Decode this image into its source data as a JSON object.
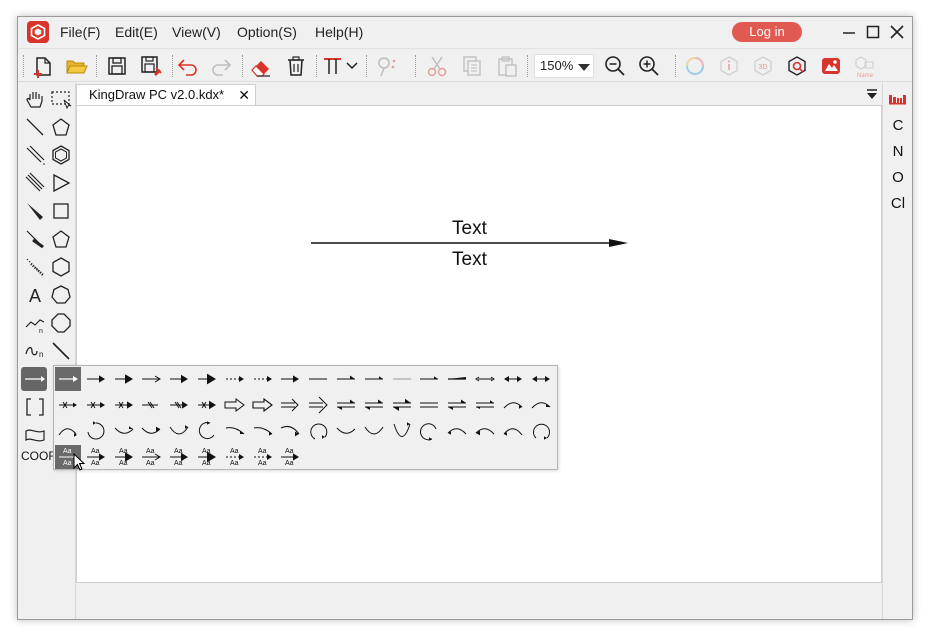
{
  "app": {
    "title": "KingDraw PC"
  },
  "menu": {
    "file": "File(F)",
    "edit": "Edit(E)",
    "view": "View(V)",
    "option": "Option(S)",
    "help": "Help(H)",
    "login": "Log in"
  },
  "toolbar": {
    "zoom": "150%",
    "icons": [
      "new-file",
      "open-folder",
      "save",
      "save-as",
      "undo",
      "redo",
      "eraser",
      "delete",
      "text-align",
      "transform",
      "cut",
      "copy",
      "paste",
      "zoom-out",
      "zoom-in",
      "color-ring",
      "info",
      "3d",
      "query",
      "image-gen",
      "name"
    ]
  },
  "document": {
    "tab_title": "KingDraw PC v2.0.kdx*",
    "tab_close": "✕",
    "canvas": {
      "text_above": "Text",
      "text_below": "Text"
    }
  },
  "left_tools": {
    "coor_label": "COOR"
  },
  "right_panel": {
    "elements": [
      "C",
      "N",
      "O",
      "Cl"
    ]
  },
  "arrow_popup": {
    "rows": 4,
    "text_sample": "Aa"
  },
  "colors": {
    "accent": "#d9342b",
    "login": "#e05a52",
    "active": "#666666"
  }
}
